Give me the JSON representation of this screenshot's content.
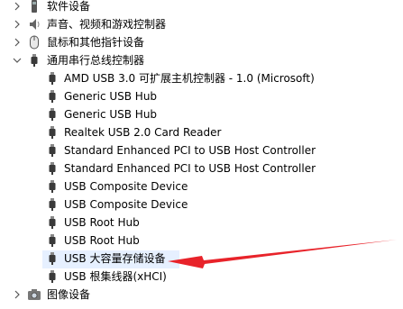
{
  "tree": {
    "categories": [
      {
        "label": "软件设备",
        "state": "collapsed",
        "icon": "software-device-icon"
      },
      {
        "label": "声音、视频和游戏控制器",
        "state": "collapsed",
        "icon": "speaker-icon"
      },
      {
        "label": "鼠标和其他指针设备",
        "state": "collapsed",
        "icon": "mouse-icon"
      },
      {
        "label": "通用串行总线控制器",
        "state": "expanded",
        "icon": "usb-icon"
      },
      {
        "label": "图像设备",
        "state": "collapsed",
        "icon": "camera-icon"
      }
    ],
    "usb_devices": [
      "AMD USB 3.0 可扩展主机控制器 - 1.0 (Microsoft)",
      "Generic USB Hub",
      "Generic USB Hub",
      "Realtek USB 2.0 Card Reader",
      "Standard Enhanced PCI to USB Host Controller",
      "Standard Enhanced PCI to USB Host Controller",
      "USB Composite Device",
      "USB Composite Device",
      "USB Root Hub",
      "USB Root Hub",
      "USB 大容量存储设备",
      "USB 根集线器(xHCI)"
    ],
    "highlighted_device_index": 10
  },
  "colors": {
    "annotation_arrow": "#e8232a",
    "chevron": "#555555",
    "usb_plug": "#3a3a3a"
  }
}
